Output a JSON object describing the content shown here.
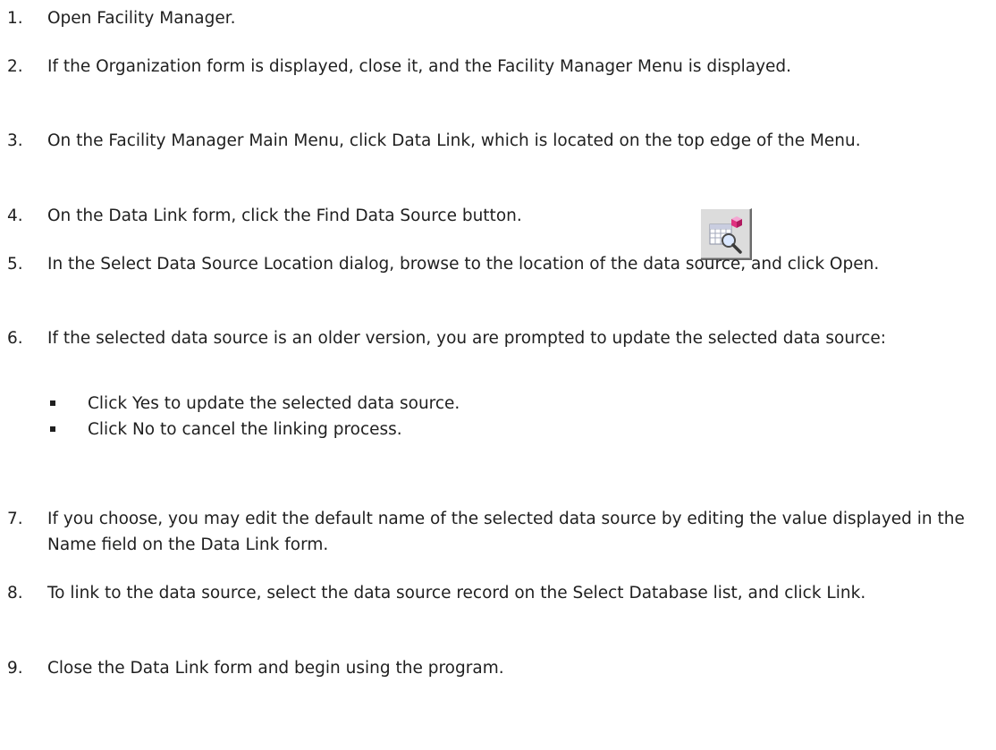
{
  "steps": [
    {
      "number": "1.",
      "text": "Open Facility Manager."
    },
    {
      "number": "2.",
      "text": "If the Organization form is displayed, close it, and the Facility Manager Menu is displayed."
    },
    {
      "number": "3.",
      "text": "On the Facility Manager Main Menu, click Data Link, which is located on the top edge of the Menu."
    },
    {
      "number": "4.",
      "text": "On the Data Link form, click the Find Data Source button."
    },
    {
      "number": "5.",
      "text": "In the Select Data Source Location dialog, browse to the location of the data source, and click Open."
    },
    {
      "number": "6.",
      "text": "If the selected data source is an older version, you are prompted to update the selected data source:"
    },
    {
      "number": "7.",
      "text": "If you choose, you may edit the default name of the selected data source by editing the value displayed in the Name field on the Data Link form."
    },
    {
      "number": "8.",
      "text": "To link to the data source, select the data source record on the Select Database list, and click Link."
    },
    {
      "number": "9.",
      "text": "Close the Data Link form and begin using the program."
    }
  ],
  "step6_bullets": [
    "Click Yes to update the selected data source.",
    "Click No to cancel the linking process."
  ],
  "find_data_source_button": {
    "icon": "find-data-source-icon"
  }
}
